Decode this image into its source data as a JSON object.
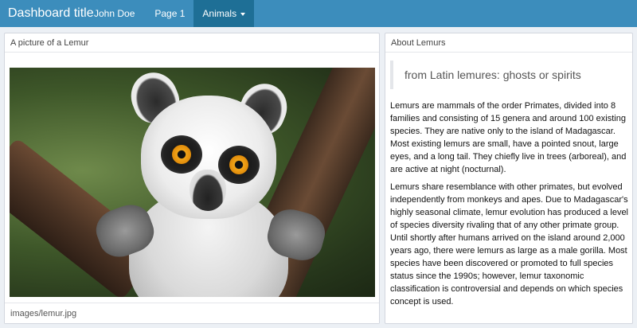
{
  "navbar": {
    "brand": "Dashboard title",
    "user": "John Doe",
    "items": [
      {
        "label": "Page 1",
        "active": false
      },
      {
        "label": "Animals",
        "active": true
      }
    ],
    "accent_color": "#3c8dbc",
    "active_color": "#1e6f96"
  },
  "left_box": {
    "title": "A picture of a Lemur",
    "footer": "images/lemur.jpg"
  },
  "right_box": {
    "title": "About Lemurs",
    "quote": "from Latin lemures: ghosts or spirits",
    "paragraphs": [
      "Lemurs are mammals of the order Primates, divided into 8 families and consisting of 15 genera and around 100 existing species. They are native only to the island of Madagascar. Most existing lemurs are small, have a pointed snout, large eyes, and a long tail. They chiefly live in trees (arboreal), and are active at night (nocturnal).",
      "Lemurs share resemblance with other primates, but evolved independently from monkeys and apes. Due to Madagascar's highly seasonal climate, lemur evolution has produced a level of species diversity rivaling that of any other primate group. Until shortly after humans arrived on the island around 2,000 years ago, there were lemurs as large as a male gorilla. Most species have been discovered or promoted to full species status since the 1990s; however, lemur taxonomic classification is controversial and depends on which species concept is used."
    ]
  },
  "icons": {
    "dropdown": "caret-down-icon"
  }
}
